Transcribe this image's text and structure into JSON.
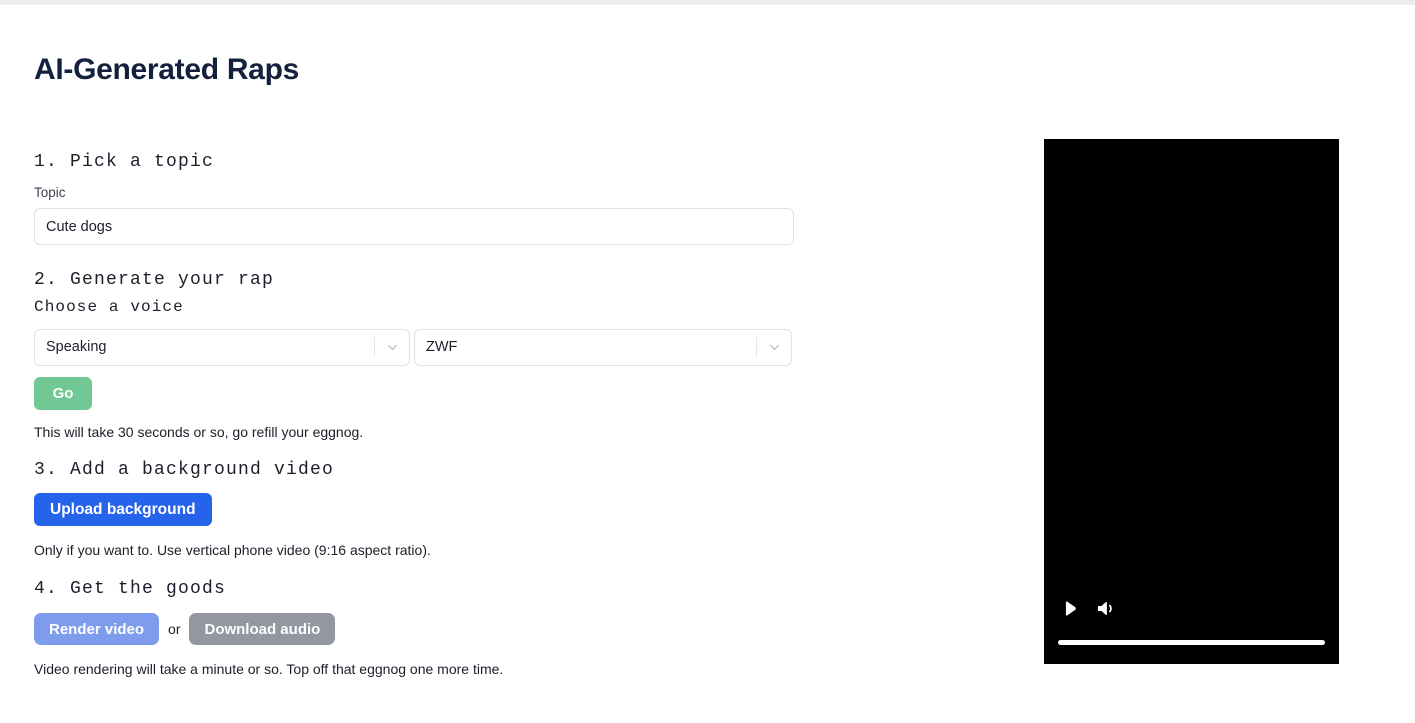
{
  "page": {
    "title": "AI-Generated Raps"
  },
  "step1": {
    "heading": "1. Pick a topic",
    "topic_label": "Topic",
    "topic_value": "Cute dogs",
    "topic_placeholder": "Topic"
  },
  "step2": {
    "heading": "2. Generate your rap",
    "voice_label": "Choose a voice",
    "style_select": {
      "value": "Speaking",
      "icon": "chevron-down-icon"
    },
    "voice_select": {
      "value": "ZWF",
      "icon": "chevron-down-icon"
    },
    "go_label": "Go",
    "helper": "This will take 30 seconds or so, go refill your eggnog."
  },
  "step3": {
    "heading": "3. Add a background video",
    "upload_label": "Upload background",
    "helper": "Only if you want to. Use vertical phone video (9:16 aspect ratio)."
  },
  "step4": {
    "heading": "4. Get the goods",
    "render_label": "Render video",
    "or_label": "or",
    "download_label": "Download audio",
    "helper": "Video rendering will take a minute or so. Top off that eggnog one more time."
  },
  "video_player": {
    "play_icon": "play-icon",
    "volume_icon": "volume-high-icon",
    "progress_percent": 100
  },
  "colors": {
    "title": "#14213d",
    "go_button": "#72c894",
    "upload_button": "#2563eb",
    "render_button": "#7d9cec",
    "download_button": "#9297a1",
    "video_background": "#000000",
    "page_background": "#ffffff"
  }
}
